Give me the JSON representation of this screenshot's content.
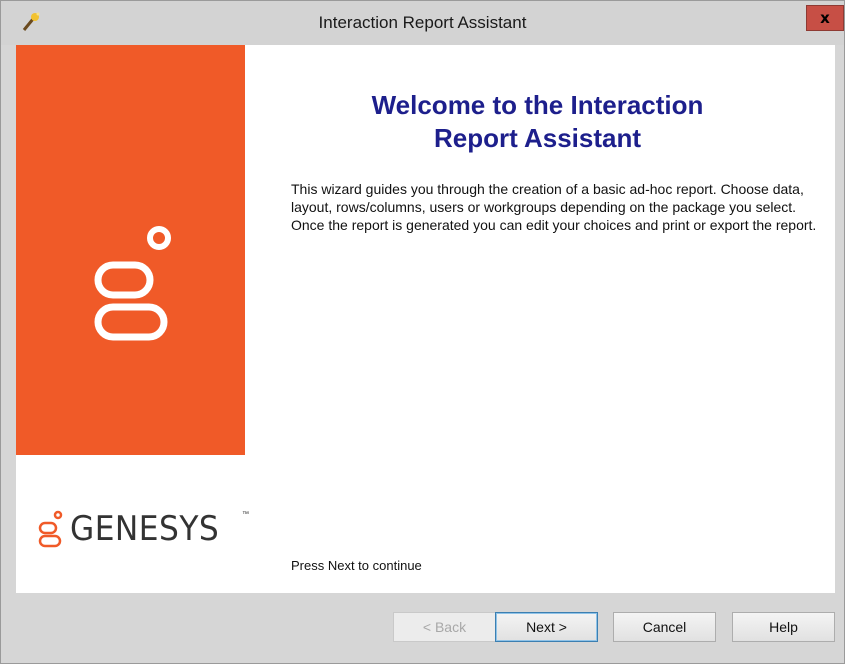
{
  "window": {
    "title": "Interaction Report Assistant",
    "close_label": "x"
  },
  "brand": {
    "wordmark": "GENESYS",
    "trademark": "™",
    "accent_color": "#f05a28"
  },
  "main": {
    "heading": "Welcome to the Interaction\nReport Assistant",
    "description": "This wizard guides you through the creation of a basic ad-hoc report. Choose data, layout,  rows/columns, users or workgroups depending on the package you select. Once the report is generated you can edit your choices and print or export the report.",
    "hint": "Press Next to continue"
  },
  "buttons": {
    "back": "< Back",
    "next": "Next >",
    "cancel": "Cancel",
    "help": "Help"
  },
  "icons": {
    "app": "wand-icon",
    "logo": "genesys-logo-icon"
  }
}
